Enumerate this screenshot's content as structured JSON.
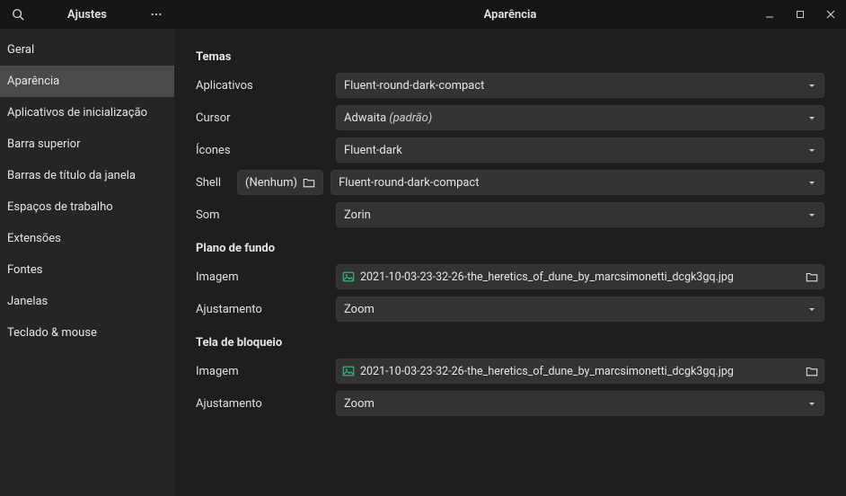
{
  "header": {
    "app_title": "Ajustes",
    "page_title": "Aparência"
  },
  "sidebar": {
    "items": [
      {
        "label": "Geral",
        "selected": false
      },
      {
        "label": "Aparência",
        "selected": true
      },
      {
        "label": "Aplicativos de inicialização",
        "selected": false
      },
      {
        "label": "Barra superior",
        "selected": false
      },
      {
        "label": "Barras de título da janela",
        "selected": false
      },
      {
        "label": "Espaços de trabalho",
        "selected": false
      },
      {
        "label": "Extensões",
        "selected": false
      },
      {
        "label": "Fontes",
        "selected": false
      },
      {
        "label": "Janelas",
        "selected": false
      },
      {
        "label": "Teclado & mouse",
        "selected": false
      }
    ]
  },
  "themes": {
    "section": "Temas",
    "rows": {
      "apps": {
        "label": "Aplicativos",
        "value": "Fluent-round-dark-compact"
      },
      "cursor": {
        "label": "Cursor",
        "value": "Adwaita",
        "suffix": "(padrão)"
      },
      "icons": {
        "label": "Ícones",
        "value": "Fluent-dark"
      },
      "shell": {
        "label": "Shell",
        "none": "(Nenhum)",
        "value": "Fluent-round-dark-compact"
      },
      "sound": {
        "label": "Som",
        "value": "Zorin"
      }
    }
  },
  "background": {
    "section": "Plano de fundo",
    "image": {
      "label": "Imagem",
      "file": "2021-10-03-23-32-26-the_heretics_of_dune_by_marcsimonetti_dcgk3gq.jpg"
    },
    "fit": {
      "label": "Ajustamento",
      "value": "Zoom"
    }
  },
  "lockscreen": {
    "section": "Tela de bloqueio",
    "image": {
      "label": "Imagem",
      "file": "2021-10-03-23-32-26-the_heretics_of_dune_by_marcsimonetti_dcgk3gq.jpg"
    },
    "fit": {
      "label": "Ajustamento",
      "value": "Zoom"
    }
  }
}
